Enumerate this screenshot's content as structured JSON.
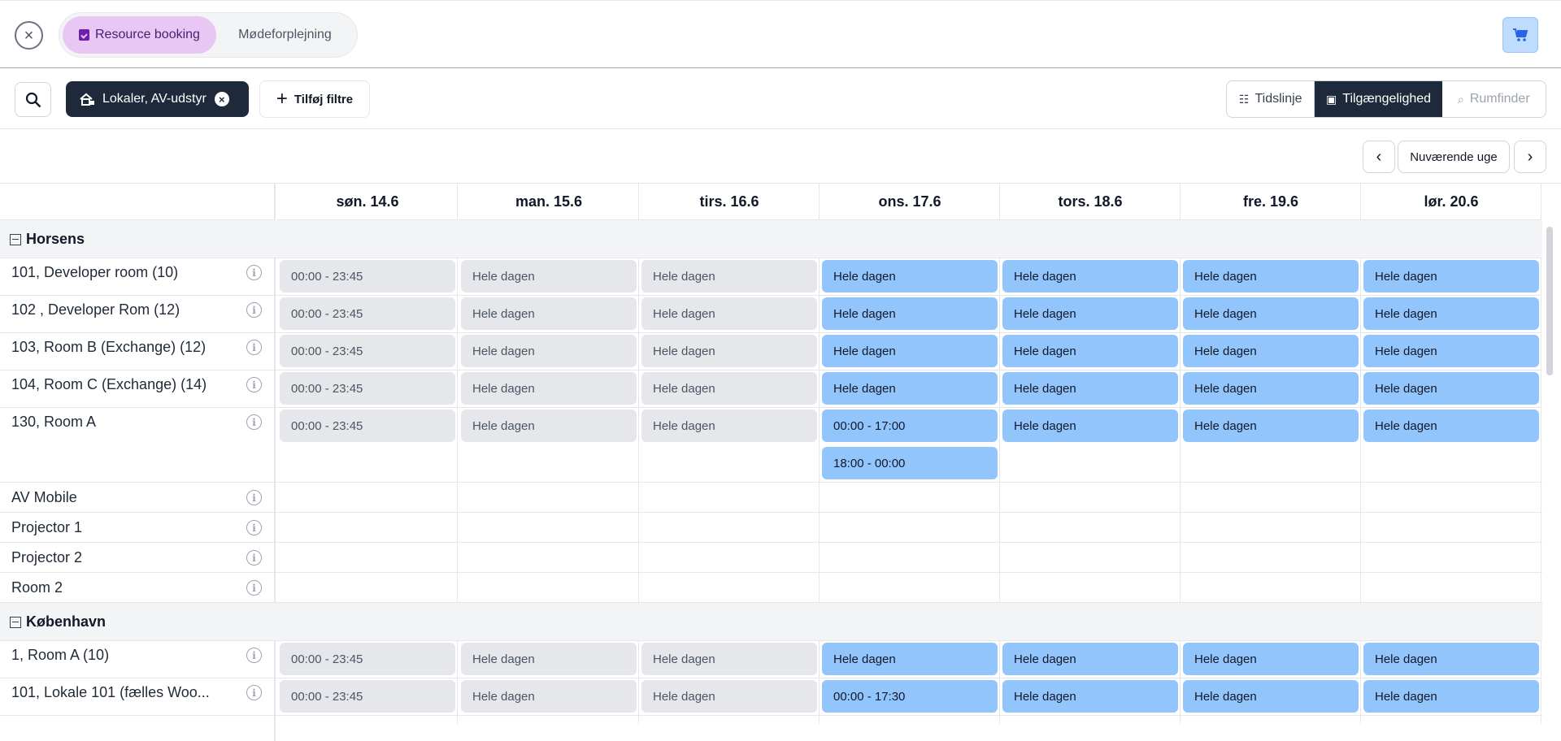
{
  "header": {
    "tabs": [
      {
        "label": "Resource booking",
        "active": true
      },
      {
        "label": "Mødeforplejning",
        "active": false
      }
    ]
  },
  "filters": {
    "chip_label": "Lokaler, AV-udstyr",
    "add_filter_label": "Tilføj filtre"
  },
  "views": [
    {
      "label": "Tidslinje",
      "icon": "timeline-icon",
      "active": false
    },
    {
      "label": "Tilgængelighed",
      "icon": "calendar-check-icon",
      "active": true
    },
    {
      "label": "Rumfinder",
      "icon": "search-room-icon",
      "active": false,
      "disabled": true
    }
  ],
  "week_nav": {
    "current_label": "Nuværende uge"
  },
  "days": [
    "søn. 14.6",
    "man. 15.6",
    "tirs. 16.6",
    "ons. 17.6",
    "tors. 18.6",
    "fre. 19.6",
    "lør. 20.6"
  ],
  "groups": [
    {
      "name": "Horsens",
      "resources": [
        {
          "name": "101, Developer room (10)",
          "slots": [
            [
              "00:00 - 23:45"
            ],
            [
              "Hele dagen"
            ],
            [
              "Hele dagen"
            ],
            [
              "Hele dagen"
            ],
            [
              "Hele dagen"
            ],
            [
              "Hele dagen"
            ],
            [
              "Hele dagen"
            ]
          ]
        },
        {
          "name": "102 , Developer Rom (12)",
          "slots": [
            [
              "00:00 - 23:45"
            ],
            [
              "Hele dagen"
            ],
            [
              "Hele dagen"
            ],
            [
              "Hele dagen"
            ],
            [
              "Hele dagen"
            ],
            [
              "Hele dagen"
            ],
            [
              "Hele dagen"
            ]
          ]
        },
        {
          "name": "103, Room B (Exchange) (12)",
          "slots": [
            [
              "00:00 - 23:45"
            ],
            [
              "Hele dagen"
            ],
            [
              "Hele dagen"
            ],
            [
              "Hele dagen"
            ],
            [
              "Hele dagen"
            ],
            [
              "Hele dagen"
            ],
            [
              "Hele dagen"
            ]
          ]
        },
        {
          "name": "104, Room C (Exchange) (14)",
          "slots": [
            [
              "00:00 - 23:45"
            ],
            [
              "Hele dagen"
            ],
            [
              "Hele dagen"
            ],
            [
              "Hele dagen"
            ],
            [
              "Hele dagen"
            ],
            [
              "Hele dagen"
            ],
            [
              "Hele dagen"
            ]
          ]
        },
        {
          "name": "130, Room A",
          "slots": [
            [
              "00:00 - 23:45"
            ],
            [
              "Hele dagen"
            ],
            [
              "Hele dagen"
            ],
            [
              "00:00 - 17:00",
              "18:00 - 00:00"
            ],
            [
              "Hele dagen"
            ],
            [
              "Hele dagen"
            ],
            [
              "Hele dagen"
            ]
          ]
        },
        {
          "name": "AV Mobile",
          "slots": []
        },
        {
          "name": "Projector 1",
          "slots": []
        },
        {
          "name": "Projector 2",
          "slots": []
        },
        {
          "name": "Room 2",
          "slots": []
        }
      ]
    },
    {
      "name": "København",
      "resources": [
        {
          "name": "1, Room A (10)",
          "slots": [
            [
              "00:00 - 23:45"
            ],
            [
              "Hele dagen"
            ],
            [
              "Hele dagen"
            ],
            [
              "Hele dagen"
            ],
            [
              "Hele dagen"
            ],
            [
              "Hele dagen"
            ],
            [
              "Hele dagen"
            ]
          ]
        },
        {
          "name": "101, Lokale 101 (fælles Woo...",
          "slots": [
            [
              "00:00 - 23:45"
            ],
            [
              "Hele dagen"
            ],
            [
              "Hele dagen"
            ],
            [
              "00:00 - 17:30"
            ],
            [
              "Hele dagen"
            ],
            [
              "Hele dagen"
            ],
            [
              "Hele dagen"
            ]
          ]
        }
      ]
    }
  ],
  "colors": {
    "free": "#93c5fd",
    "busy": "#e5e7eb",
    "accent": "#1e293b",
    "brand": "#e9c7f4"
  }
}
